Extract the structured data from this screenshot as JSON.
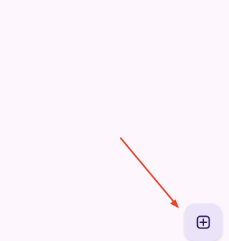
{
  "screen": {
    "background": "#fdf7fd"
  },
  "annotation": {
    "type": "arrow",
    "color": "#e2462f"
  },
  "fab": {
    "icon": "add-box-icon",
    "background": "#ebe3f8",
    "icon_color": "#2a1a5e"
  }
}
